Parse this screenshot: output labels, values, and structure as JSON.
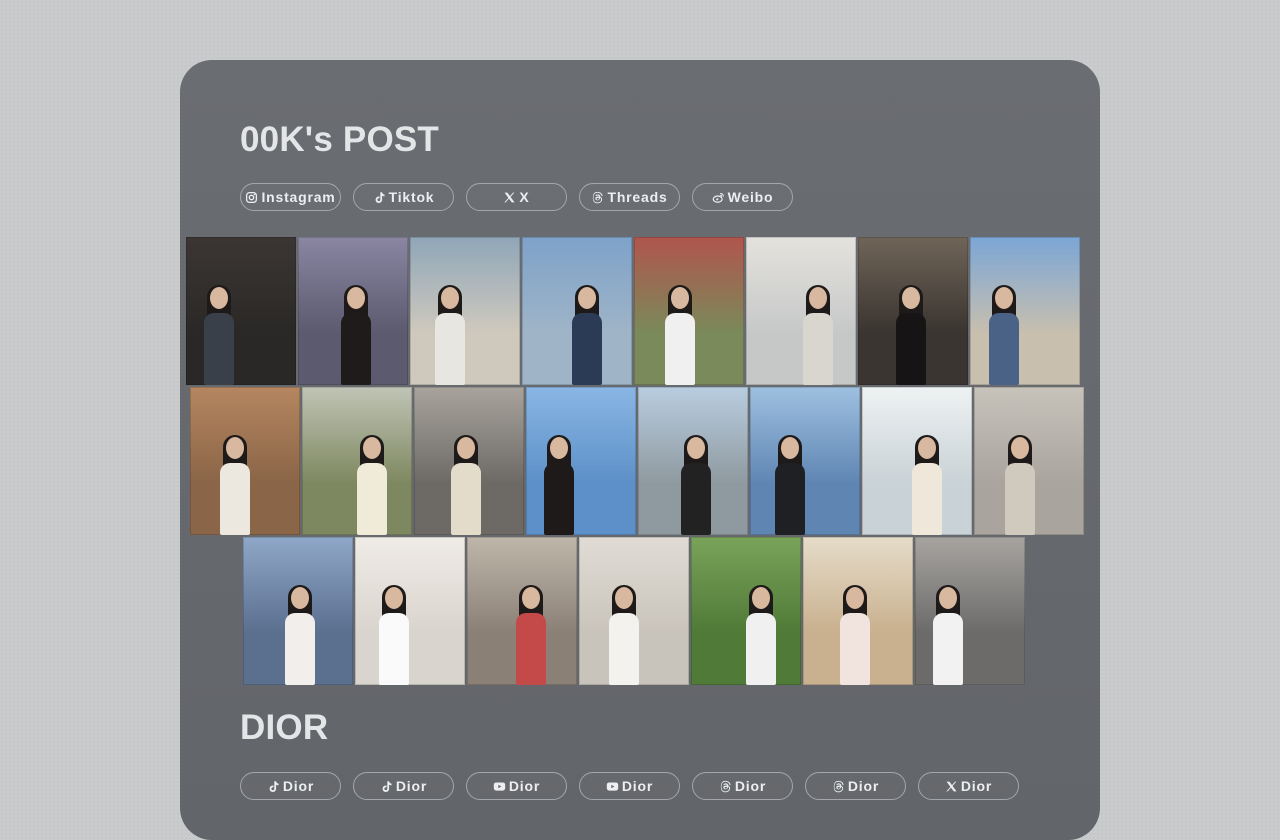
{
  "sections": [
    {
      "title": "00K's POST",
      "links": [
        {
          "label": "Instagram",
          "icon": "instagram-icon"
        },
        {
          "label": "Tiktok",
          "icon": "tiktok-icon"
        },
        {
          "label": "X",
          "icon": "x-icon"
        },
        {
          "label": "Threads",
          "icon": "threads-icon"
        },
        {
          "label": "Weibo",
          "icon": "weibo-icon"
        }
      ]
    },
    {
      "title": "DIOR",
      "links": [
        {
          "label": "Dior",
          "icon": "tiktok-icon"
        },
        {
          "label": "Dior",
          "icon": "tiktok-icon"
        },
        {
          "label": "Dior",
          "icon": "youtube-icon"
        },
        {
          "label": "Dior",
          "icon": "youtube-icon"
        },
        {
          "label": "Dior",
          "icon": "threads-icon"
        },
        {
          "label": "Dior",
          "icon": "threads-icon"
        },
        {
          "label": "Dior",
          "icon": "x-icon"
        }
      ]
    }
  ],
  "photo_rows": [
    [
      {
        "bg": "#2a2826",
        "top": "#3b3634",
        "outfit": "#3a4049"
      },
      {
        "bg": "#5b5a6e",
        "top": "#8a86a3",
        "outfit": "#1e1b1a"
      },
      {
        "bg": "#cfc9bd",
        "top": "#8fa6b8",
        "outfit": "#e8e6e0"
      },
      {
        "bg": "#9fb4c7",
        "top": "#7ea2c9",
        "outfit": "#2b3b55"
      },
      {
        "bg": "#7a8a5a",
        "top": "#b0554d",
        "outfit": "#f0f0f0"
      },
      {
        "bg": "#c6c8c8",
        "top": "#e4e2dd",
        "outfit": "#d8d6cf"
      },
      {
        "bg": "#3a3530",
        "top": "#6f6458",
        "outfit": "#161414"
      },
      {
        "bg": "#c8bfae",
        "top": "#7ba6d6",
        "outfit": "#4a6285"
      }
    ],
    [
      {
        "bg": "#8a6547",
        "top": "#b58660",
        "outfit": "#ece8df"
      },
      {
        "bg": "#7e8860",
        "top": "#c0c4b6",
        "outfit": "#f0ebd8"
      },
      {
        "bg": "#6d6a66",
        "top": "#a8a39c",
        "outfit": "#e4dccb"
      },
      {
        "bg": "#5d90c8",
        "top": "#89b6e4",
        "outfit": "#1d1a19"
      },
      {
        "bg": "#8f9aa0",
        "top": "#b9cde0",
        "outfit": "#232222"
      },
      {
        "bg": "#5f86b3",
        "top": "#9ec0e0",
        "outfit": "#1e2024"
      },
      {
        "bg": "#c9d2d6",
        "top": "#eef2f3",
        "outfit": "#efe7da"
      },
      {
        "bg": "#a9a59e",
        "top": "#c7c3bb",
        "outfit": "#cfc9be"
      }
    ],
    [
      {
        "bg": "#5b6f8f",
        "top": "#8fa7c8",
        "outfit": "#f1eeec"
      },
      {
        "bg": "#d9d4cd",
        "top": "#efebe6",
        "outfit": "#fafafa"
      },
      {
        "bg": "#8a8076",
        "top": "#bfb6aa",
        "outfit": "#c44a4a"
      },
      {
        "bg": "#c9c4bb",
        "top": "#e0dcd5",
        "outfit": "#f4f2ee"
      },
      {
        "bg": "#4f7a37",
        "top": "#7aa35a",
        "outfit": "#f0f0f0"
      },
      {
        "bg": "#c9b08e",
        "top": "#e5dcc9",
        "outfit": "#f1e3de"
      },
      {
        "bg": "#6c6b6a",
        "top": "#a7a4a0",
        "outfit": "#f2f2f2"
      }
    ]
  ]
}
